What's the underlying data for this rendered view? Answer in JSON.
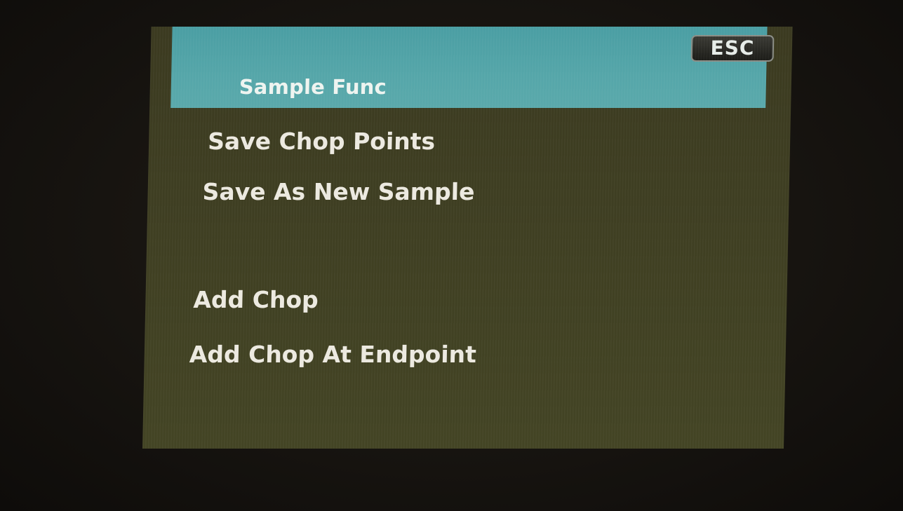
{
  "screen": {
    "title": "Sample Func",
    "esc_label": "ESC"
  },
  "menu": {
    "items": [
      {
        "label": "Save Chop Points"
      },
      {
        "label": "Save As New Sample"
      },
      {
        "label": "Add Chop"
      },
      {
        "label": "Add Chop At Endpoint"
      }
    ]
  },
  "colors": {
    "header_bg": "#55a6a9",
    "screen_bg": "#3f3f22",
    "text": "#ece9e0"
  }
}
